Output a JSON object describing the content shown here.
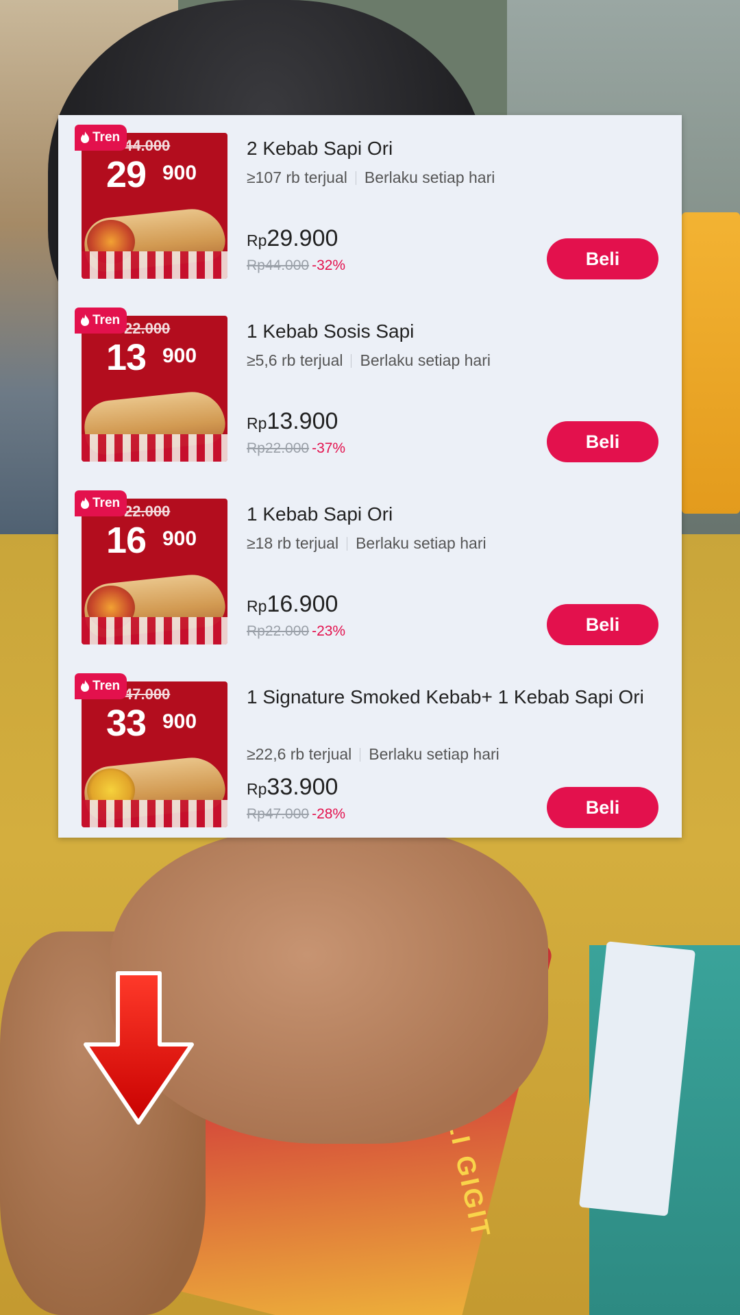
{
  "colors": {
    "accent": "#e3114d",
    "panel": "#ecf0f7",
    "thumb_red": "#b30d1e"
  },
  "deals": [
    {
      "badge": "Tren",
      "thumb": {
        "old": "44.000",
        "big": "29",
        "small": "900"
      },
      "title": "2 Kebab Sapi Ori",
      "sold": "≥107 rb terjual",
      "validity": "Berlaku setiap hari",
      "currency": "Rp",
      "price": "29.900",
      "original_price": "Rp44.000",
      "discount": "-32%",
      "button": "Beli"
    },
    {
      "badge": "Tren",
      "thumb": {
        "old": "22.000",
        "big": "13",
        "small": "900"
      },
      "title": "1 Kebab Sosis Sapi",
      "sold": "≥5,6 rb terjual",
      "validity": "Berlaku setiap hari",
      "currency": "Rp",
      "price": "13.900",
      "original_price": "Rp22.000",
      "discount": "-37%",
      "button": "Beli"
    },
    {
      "badge": "Tren",
      "thumb": {
        "old": "22.000",
        "big": "16",
        "small": "900"
      },
      "title": "1 Kebab Sapi Ori",
      "sold": "≥18 rb terjual",
      "validity": "Berlaku setiap hari",
      "currency": "Rp",
      "price": "16.900",
      "original_price": "Rp22.000",
      "discount": "-23%",
      "button": "Beli"
    },
    {
      "badge": "Tren",
      "thumb": {
        "old": "47.000",
        "big": "33",
        "small": "900"
      },
      "title": "1 Signature Smoked Kebab+ 1 Kebab Sapi Ori",
      "sold": "≥22,6 rb terjual",
      "validity": "Berlaku setiap hari",
      "currency": "Rp",
      "price": "33.900",
      "original_price": "Rp47.000",
      "discount": "-28%",
      "button": "Beli"
    }
  ],
  "background": {
    "wrapper_text": "SEKALI GIGIT"
  }
}
